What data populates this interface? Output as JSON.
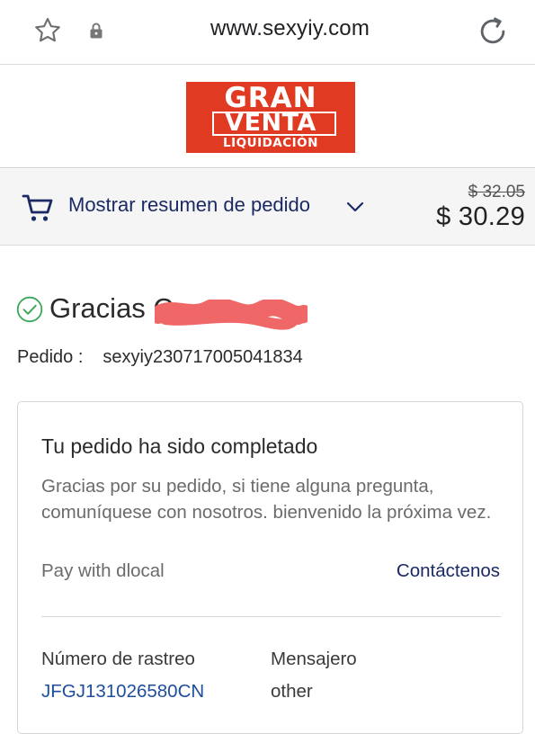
{
  "browser": {
    "url": "www.sexyiy.com",
    "icons": [
      "star-icon",
      "lock-icon",
      "reload-icon"
    ]
  },
  "logo": {
    "line1": "GRAN",
    "line2": "VENTA",
    "line3": "LIQUIDACIÓN"
  },
  "summary": {
    "toggle_label": "Mostrar resumen de pedido",
    "original_price": "$ 32.05",
    "price": "$ 30.29",
    "icons": [
      "cart-icon",
      "chevron-down-icon"
    ]
  },
  "thanks": {
    "title": "Gracias C",
    "order_label": "Pedido :",
    "order_number": "sexyiy230717005041834"
  },
  "status_card": {
    "title": "Tu pedido ha sido completado",
    "body": "Gracias por su pedido, si tiene alguna pregunta, comuníquese con nosotros. bienvenido la próxima vez.",
    "payment_method": "Pay with dlocal",
    "contact_link": "Contáctenos",
    "tracking_label": "Número de rastreo",
    "tracking_number": "JFGJ131026580CN",
    "courier_label": "Mensajero",
    "courier_value": "other"
  },
  "colors": {
    "brand_red": "#e03a22",
    "link_navy": "#1b2a64",
    "link_blue": "#1d4e9b",
    "success_green": "#3aa757",
    "redaction": "#f06767"
  }
}
